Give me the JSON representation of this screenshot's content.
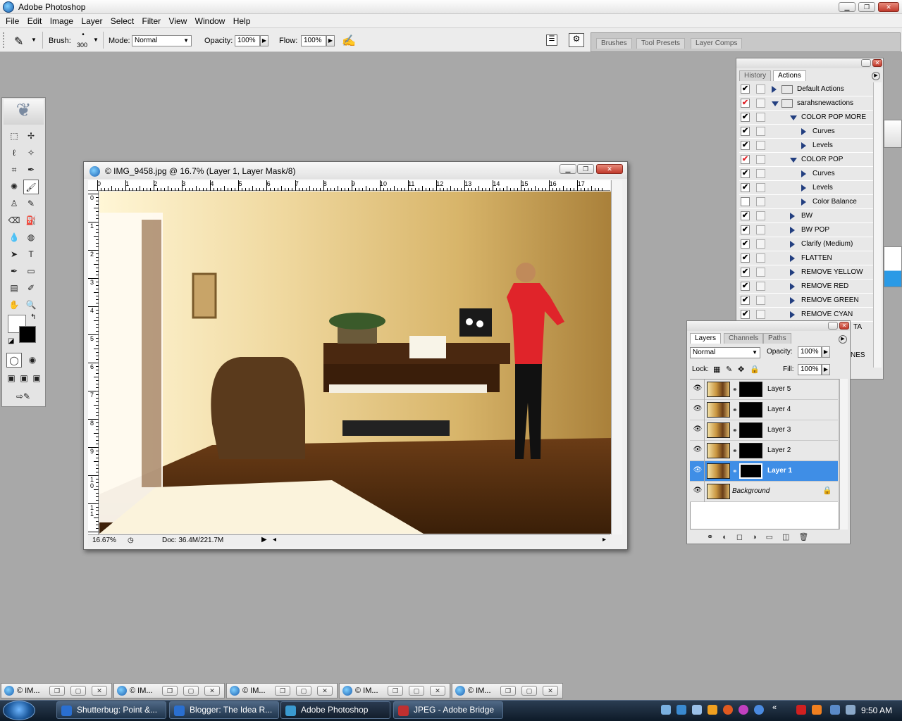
{
  "app": {
    "title": "Adobe Photoshop"
  },
  "menu": [
    "File",
    "Edit",
    "Image",
    "Layer",
    "Select",
    "Filter",
    "View",
    "Window",
    "Help"
  ],
  "options": {
    "brush_label": "Brush:",
    "brush_size": "300",
    "mode_label": "Mode:",
    "mode_value": "Normal",
    "opacity_label": "Opacity:",
    "opacity_value": "100%",
    "flow_label": "Flow:",
    "flow_value": "100%",
    "well_tabs": [
      "Brushes",
      "Tool Presets",
      "Layer Comps"
    ]
  },
  "document": {
    "title": "© IMG_9458.jpg @ 16.7% (Layer 1, Layer Mask/8)",
    "zoom": "16.67%",
    "doc_size": "Doc: 36.4M/221.7M",
    "ruler_h": [
      "0",
      "1",
      "2",
      "3",
      "4",
      "5",
      "6",
      "7",
      "8",
      "9",
      "10",
      "11",
      "12",
      "13",
      "14",
      "15",
      "16",
      "17"
    ],
    "ruler_v": [
      "0",
      "1",
      "2",
      "3",
      "4",
      "5",
      "6",
      "7",
      "8",
      "9",
      "1\n0",
      "1\n1"
    ]
  },
  "actions_panel": {
    "tabs": [
      "History",
      "Actions"
    ],
    "rows": [
      {
        "label": "Default Actions",
        "kind": "set",
        "open": false,
        "checked": true,
        "red": false,
        "indent": 0
      },
      {
        "label": "sarahsnewactions",
        "kind": "set",
        "open": true,
        "checked": true,
        "red": true,
        "indent": 0
      },
      {
        "label": "COLOR POP MORE",
        "kind": "action",
        "open": true,
        "checked": true,
        "red": false,
        "indent": 1
      },
      {
        "label": "Curves",
        "kind": "step",
        "open": false,
        "checked": true,
        "red": false,
        "indent": 2
      },
      {
        "label": "Levels",
        "kind": "step",
        "open": false,
        "checked": true,
        "red": false,
        "indent": 2
      },
      {
        "label": "COLOR POP",
        "kind": "action",
        "open": true,
        "checked": true,
        "red": true,
        "indent": 1
      },
      {
        "label": "Curves",
        "kind": "step",
        "open": false,
        "checked": true,
        "red": false,
        "indent": 2
      },
      {
        "label": "Levels",
        "kind": "step",
        "open": false,
        "checked": true,
        "red": false,
        "indent": 2
      },
      {
        "label": "Color Balance",
        "kind": "step",
        "open": false,
        "checked": false,
        "red": false,
        "indent": 2
      },
      {
        "label": "BW",
        "kind": "action",
        "open": false,
        "checked": true,
        "red": false,
        "indent": 1
      },
      {
        "label": "BW POP",
        "kind": "action",
        "open": false,
        "checked": true,
        "red": false,
        "indent": 1
      },
      {
        "label": "Clarify (Medium)",
        "kind": "action",
        "open": false,
        "checked": true,
        "red": false,
        "indent": 1
      },
      {
        "label": "FLATTEN",
        "kind": "action",
        "open": false,
        "checked": true,
        "red": false,
        "indent": 1
      },
      {
        "label": "REMOVE YELLOW",
        "kind": "action",
        "open": false,
        "checked": true,
        "red": false,
        "indent": 1
      },
      {
        "label": "REMOVE RED",
        "kind": "action",
        "open": false,
        "checked": true,
        "red": false,
        "indent": 1
      },
      {
        "label": "REMOVE GREEN",
        "kind": "action",
        "open": false,
        "checked": true,
        "red": false,
        "indent": 1
      },
      {
        "label": "REMOVE CYAN",
        "kind": "action",
        "open": false,
        "checked": true,
        "red": false,
        "indent": 1
      }
    ],
    "hidden_tail_1": "TA",
    "hidden_tail_2": "NES"
  },
  "layers_panel": {
    "tabs": [
      "Layers",
      "Channels",
      "Paths"
    ],
    "blend_mode": "Normal",
    "opacity_label": "Opacity:",
    "opacity_value": "100%",
    "lock_label": "Lock:",
    "fill_label": "Fill:",
    "fill_value": "100%",
    "layers": [
      {
        "name": "Layer 5",
        "selected": false,
        "mask": true
      },
      {
        "name": "Layer 4",
        "selected": false,
        "mask": true
      },
      {
        "name": "Layer 3",
        "selected": false,
        "mask": true
      },
      {
        "name": "Layer 2",
        "selected": false,
        "mask": true
      },
      {
        "name": "Layer 1",
        "selected": true,
        "mask": true
      },
      {
        "name": "Background",
        "selected": false,
        "mask": false
      }
    ]
  },
  "minimized": [
    "© IM...",
    "© IM...",
    "© IM...",
    "© IM...",
    "© IM..."
  ],
  "taskbar": {
    "buttons": [
      {
        "label": "Shutterbug: Point &...",
        "color": "#2a6fd0"
      },
      {
        "label": "Blogger: The Idea R...",
        "color": "#2a6fd0"
      },
      {
        "label": "Adobe Photoshop",
        "color": "#3a9ad0"
      },
      {
        "label": "JPEG - Adobe Bridge",
        "color": "#c03030"
      }
    ],
    "clock": "9:50 AM"
  },
  "colors": {
    "selection": "#3f8ee6",
    "accent_red": "#e0242a"
  }
}
